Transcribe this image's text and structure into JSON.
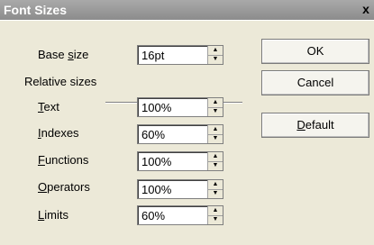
{
  "window": {
    "title": "Font Sizes",
    "close_glyph": "x"
  },
  "base_size": {
    "label_prefix": "Base ",
    "label_u": "s",
    "label_suffix": "ize",
    "value": "16pt"
  },
  "relative_section": {
    "label": "Relative sizes"
  },
  "rows": [
    {
      "label_u": "T",
      "label_rest": "ext",
      "value": "100%"
    },
    {
      "label_u": "I",
      "label_rest": "ndexes",
      "value": "60%"
    },
    {
      "label_u": "F",
      "label_rest": "unctions",
      "value": "100%"
    },
    {
      "label_u": "O",
      "label_rest": "perators",
      "value": "100%"
    },
    {
      "label_u": "L",
      "label_rest": "imits",
      "value": "60%"
    }
  ],
  "buttons": {
    "ok": "OK",
    "cancel": "Cancel",
    "default_u": "D",
    "default_rest": "efault"
  },
  "spin_icons": {
    "up": "▲",
    "down": "▼"
  }
}
